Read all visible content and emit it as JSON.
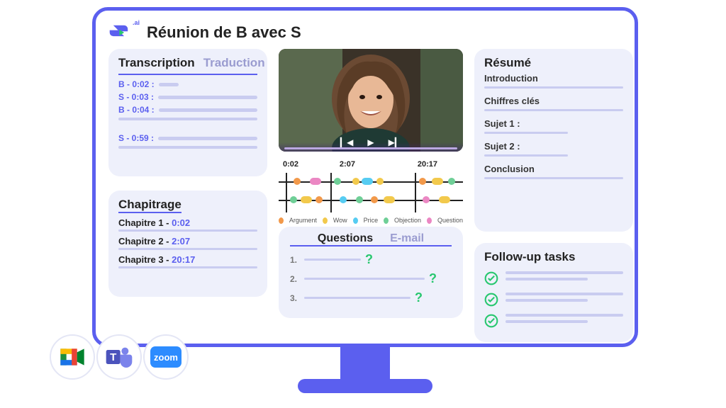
{
  "header": {
    "title": "Réunion de B avec S",
    "logo_ai": ".ai"
  },
  "transcription": {
    "tabs": {
      "transcription": "Transcription",
      "traduction": "Traduction"
    },
    "lines": [
      {
        "speaker": "B - 0:02 :"
      },
      {
        "speaker": "S - 0:03 :"
      },
      {
        "speaker": "B - 0:04 :"
      },
      {
        "speaker": "S - 0:59 :"
      }
    ]
  },
  "chapters": {
    "title": "Chapitrage",
    "items": [
      {
        "label": "Chapitre 1 - ",
        "time": "0:02"
      },
      {
        "label": "Chapitre 2 - ",
        "time": "2:07"
      },
      {
        "label": "Chapitre 3 - ",
        "time": "20:17"
      }
    ]
  },
  "timeline": {
    "markers": [
      "0:02",
      "2:07",
      "20:17"
    ],
    "legend": [
      {
        "label": "Argument",
        "color": "#f2994a"
      },
      {
        "label": "Wow",
        "color": "#f2c94c"
      },
      {
        "label": "Price",
        "color": "#56ccf2"
      },
      {
        "label": "Objection",
        "color": "#6fcf97"
      },
      {
        "label": "Question",
        "color": "#eb87c3"
      }
    ]
  },
  "questions": {
    "tabs": {
      "questions": "Questions",
      "email": "E-mail"
    },
    "items": [
      "1.",
      "2.",
      "3."
    ]
  },
  "resume": {
    "title": "Résumé",
    "rows": [
      "Introduction",
      "Chiffres clés",
      "Sujet 1 :",
      "Sujet 2 :",
      "Conclusion"
    ]
  },
  "followup": {
    "title": "Follow-up tasks",
    "count": 3
  },
  "integrations": {
    "zoom": "zoom"
  }
}
